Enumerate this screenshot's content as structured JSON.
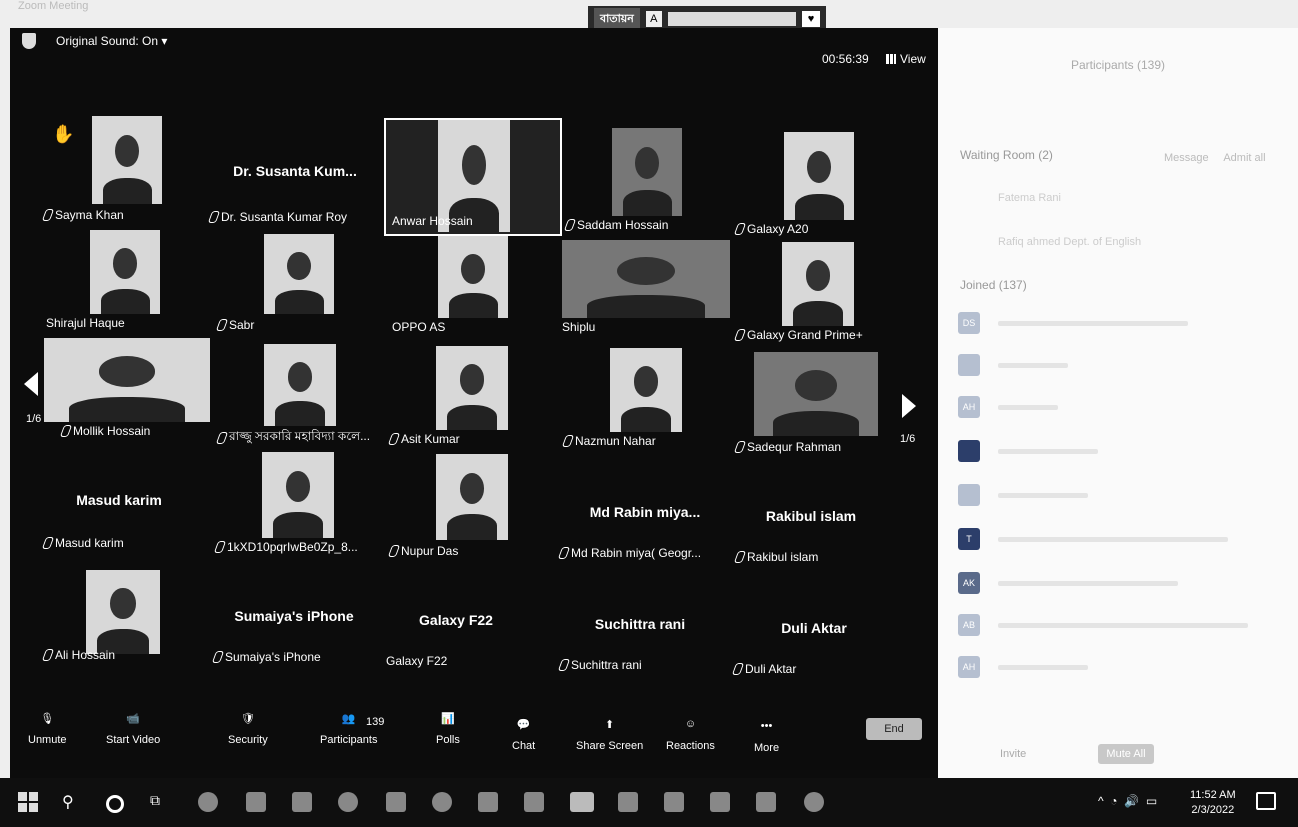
{
  "app_title": "Zoom Meeting",
  "share_bar": {
    "label": "বাতায়ন",
    "icon_text": "A"
  },
  "meeting": {
    "original_sound": "Original Sound: On",
    "timer": "00:56:39",
    "view_label": "View",
    "page_left": "1/6",
    "page_right": "1/6"
  },
  "tiles": {
    "sayma": {
      "name": "Sayma Khan"
    },
    "susanta": {
      "big": "Dr. Susanta Kum...",
      "name": "Dr. Susanta Kumar Roy"
    },
    "anwar": {
      "name": "Anwar Hossain"
    },
    "saddam": {
      "name": "Saddam Hossain"
    },
    "galaxy_a20": {
      "name": "Galaxy A20"
    },
    "shirajul": {
      "name": "Shirajul Haque"
    },
    "sabr": {
      "name": "Sabr"
    },
    "oppo": {
      "name": "OPPO AS"
    },
    "shiplu": {
      "name": "Shiplu"
    },
    "galaxy_grand": {
      "name": "Galaxy Grand Prime+"
    },
    "mollik": {
      "name": "Mollik Hossain"
    },
    "rajju": {
      "name": "রাজ্জু সরকারি মহাবিদ্যা কলে..."
    },
    "asit": {
      "name": "Asit Kumar"
    },
    "nazmun": {
      "name": "Nazmun Nahar"
    },
    "sadequr": {
      "name": "Sadequr Rahman"
    },
    "masud": {
      "big": "Masud karim",
      "name": "Masud karim"
    },
    "ikxd": {
      "name": "1kXD10pqrIwBe0Zp_8..."
    },
    "nupur": {
      "name": "Nupur Das"
    },
    "rabin": {
      "big": "Md Rabin  miya...",
      "name": "Md Rabin  miya( Geogr..."
    },
    "rakibul": {
      "big": "Rakibul islam",
      "name": "Rakibul islam"
    },
    "ali": {
      "name": "Ali Hossain"
    },
    "sumaiya": {
      "big": "Sumaiya's iPhone",
      "name": "Sumaiya's iPhone"
    },
    "galaxy_f22": {
      "big": "Galaxy F22",
      "name": "Galaxy F22"
    },
    "suchittra": {
      "big": "Suchittra rani",
      "name": "Suchittra rani"
    },
    "duli": {
      "big": "Duli Aktar",
      "name": "Duli Aktar"
    }
  },
  "toolbar": {
    "unmute": "Unmute",
    "start_video": "Start Video",
    "security": "Security",
    "participants": "Participants",
    "participants_count": "139",
    "polls": "Polls",
    "chat": "Chat",
    "share_screen": "Share Screen",
    "reactions": "Reactions",
    "more": "More",
    "end": "End"
  },
  "panel": {
    "title": "Participants (139)",
    "waiting_room": "Waiting Room (2)",
    "message": "Message",
    "admit_all": "Admit all",
    "waiting": [
      "Fatema Rani",
      "Rafiq ahmed Dept. of English"
    ],
    "joined": "Joined (137)",
    "avatars": [
      "DS",
      "",
      "AH",
      "",
      "",
      "T",
      "AK",
      "AB",
      "AH"
    ],
    "invite": "Invite",
    "mute_all": "Mute All"
  },
  "taskbar": {
    "time": "11:52 AM",
    "date": "2/3/2022"
  }
}
